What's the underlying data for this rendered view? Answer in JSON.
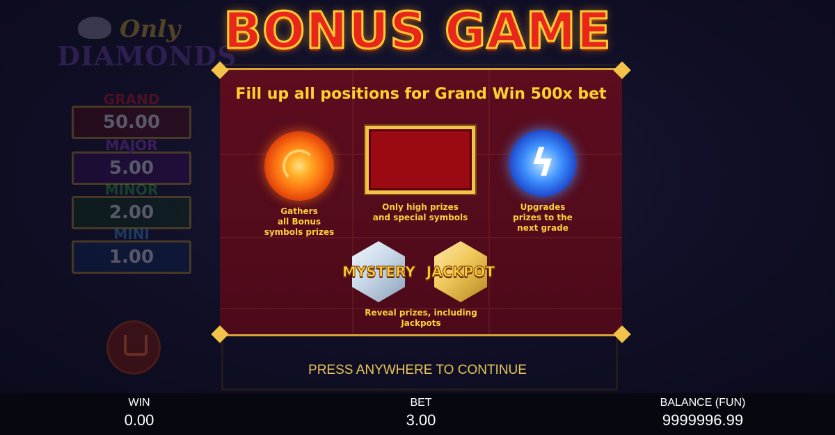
{
  "logo": {
    "line1": "Only",
    "line2": "DIAMONDS"
  },
  "jackpots": [
    {
      "label": "GRAND",
      "value": "50.00",
      "color": "#d2161e"
    },
    {
      "label": "MAJOR",
      "value": "5.00",
      "color": "#7a1fa8"
    },
    {
      "label": "MINOR",
      "value": "2.00",
      "color": "#1f8a2a"
    },
    {
      "label": "MINI",
      "value": "1.00",
      "color": "#1a74c8"
    }
  ],
  "bonus": {
    "title": "BONUS GAME",
    "subtitle": "Fill up all positions for Grand Win 500x bet",
    "features": [
      {
        "icon": "fireball-icon",
        "desc": "Gathers\nall Bonus\nsymbols prizes"
      },
      {
        "icon": "red-frame-icon",
        "desc": "Only high prizes\nand special symbols"
      },
      {
        "icon": "lightning-icon",
        "desc": "Upgrades\nprizes to the\nnext grade"
      }
    ],
    "mystery_label": "MYSTERY",
    "jackpot_label": "JACKPOT",
    "reveal_desc": "Reveal prizes, including\nJackpots",
    "continue_text": "PRESS ANYWHERE TO CONTINUE"
  },
  "footer": {
    "win_label": "WIN",
    "win_value": "0.00",
    "bet_label": "BET",
    "bet_value": "3.00",
    "balance_label": "BALANCE (FUN)",
    "balance_value": "9999996.99"
  },
  "colors": {
    "title_red": "#e8261a",
    "gold": "#ffd12e",
    "panel": "#5c0d1e"
  }
}
